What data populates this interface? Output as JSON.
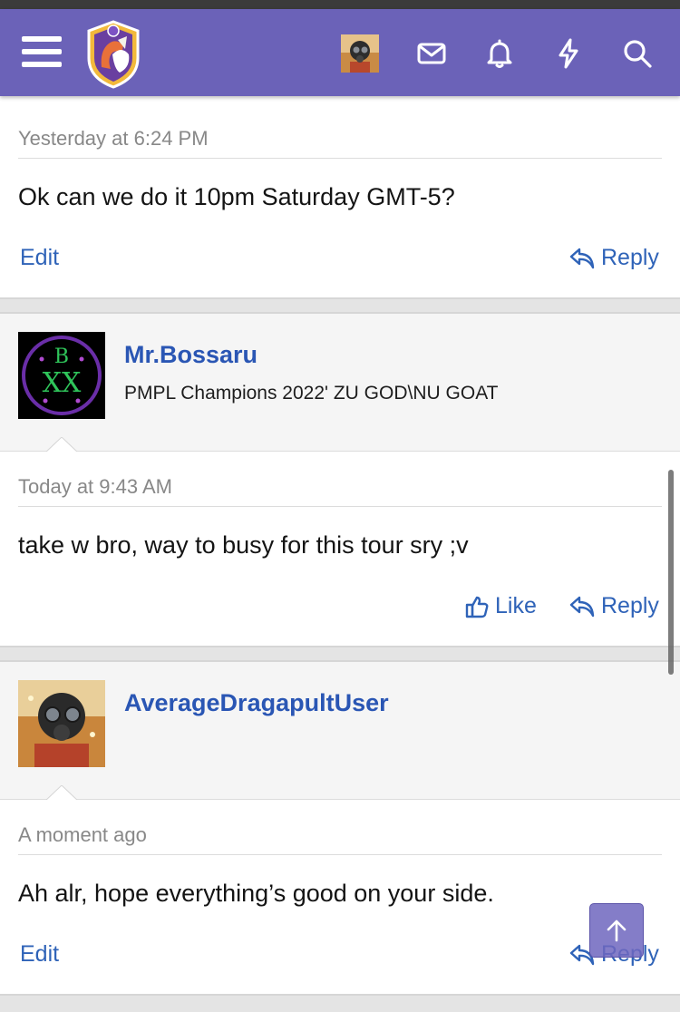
{
  "header": {
    "menu_icon": "hamburger-menu-icon",
    "logo_icon": "forum-crest-logo",
    "icons": [
      "mail-icon",
      "bell-icon",
      "bolt-icon",
      "search-icon"
    ],
    "color": "#6b62b8"
  },
  "posts": [
    {
      "time": "Yesterday at 6:24 PM",
      "text": "Ok can we do it 10pm Saturday GMT-5?",
      "actions": {
        "edit": "Edit",
        "reply": "Reply"
      }
    },
    {
      "author": "Mr.Bossaru",
      "title": "PMPL Champions 2022' ZU GOD\\NU GOAT",
      "time": "Today at 9:43 AM",
      "text": "take w bro, way to busy for this tour sry ;v",
      "actions": {
        "like": "Like",
        "reply": "Reply"
      }
    },
    {
      "author": "AverageDragapultUser",
      "time": "A moment ago",
      "text": "Ah alr, hope everything’s good on your side.",
      "actions": {
        "edit": "Edit",
        "reply": "Reply"
      }
    }
  ],
  "colors": {
    "link": "#2f63b8",
    "username": "#2a56b4"
  }
}
